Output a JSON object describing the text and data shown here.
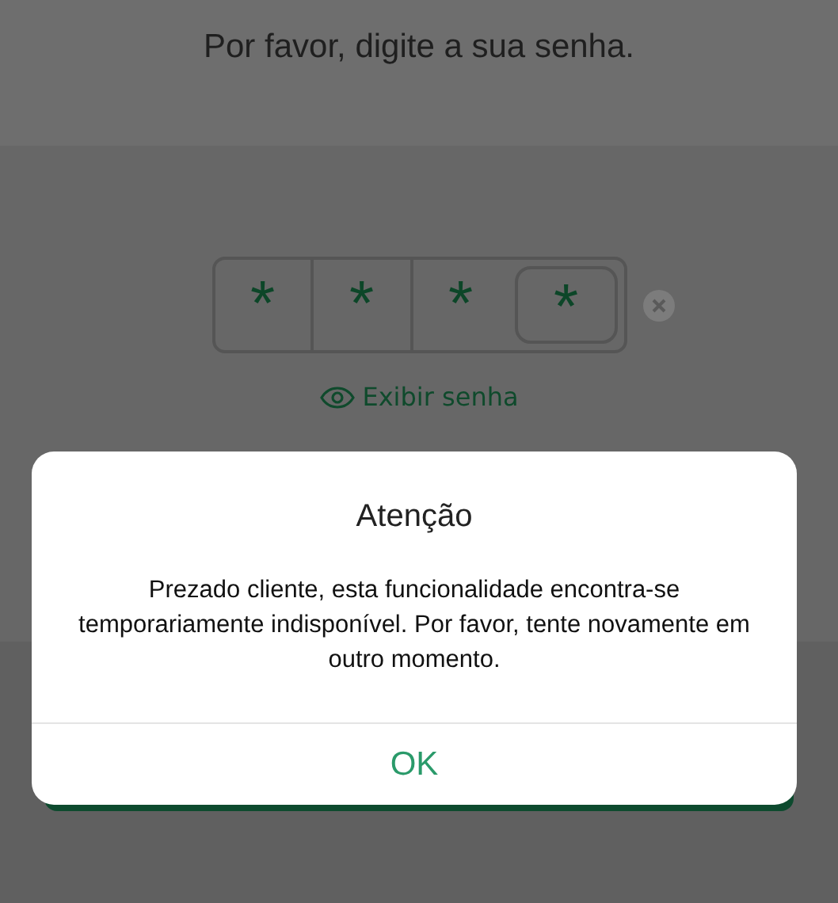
{
  "header": {
    "title": "Por favor, digite a sua senha."
  },
  "pin": {
    "cells": [
      {
        "text": "*",
        "focused": false
      },
      {
        "text": "*",
        "focused": false
      },
      {
        "text": "*",
        "focused": false
      },
      {
        "text": "*",
        "focused": true
      }
    ]
  },
  "show_password": {
    "label": "Exibir senha"
  },
  "dialog": {
    "title": "Atenção",
    "message": "Prezado cliente, esta funcionalidade encontra-se temporariamente indisponível. Por favor, tente novamente em outro momento.",
    "button": "OK"
  }
}
